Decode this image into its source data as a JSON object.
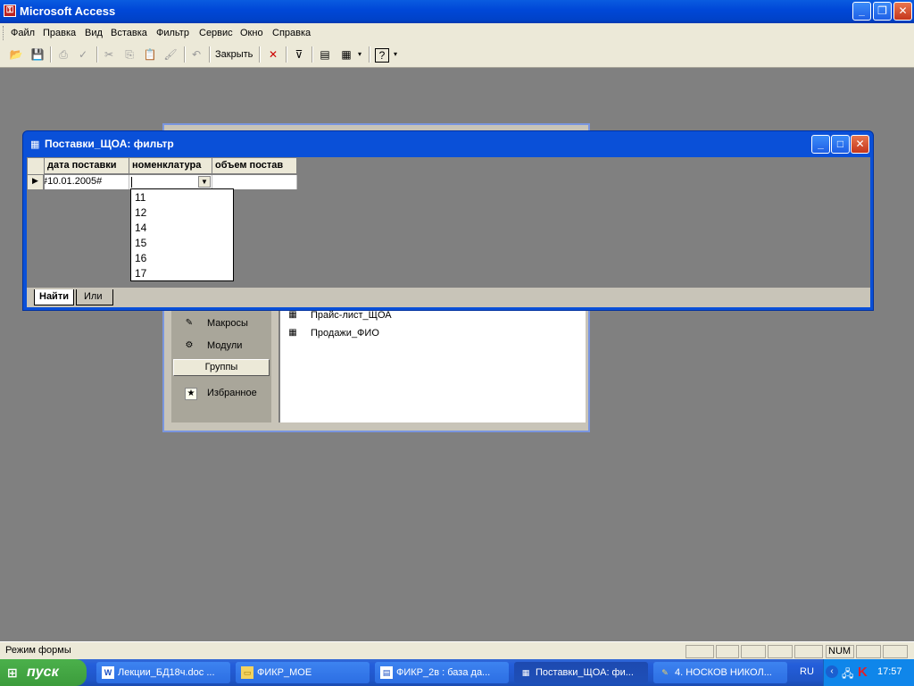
{
  "app": {
    "title": "Microsoft Access"
  },
  "menu": [
    "Файл",
    "Правка",
    "Вид",
    "Вставка",
    "Фильтр",
    "Сервис",
    "Окно",
    "Справка"
  ],
  "toolbar": {
    "close_label": "Закрыть"
  },
  "db_window": {
    "left_items": [
      "Макросы",
      "Модули"
    ],
    "groups_label": "Группы",
    "favorites_label": "Избранное",
    "objects": [
      "Прайс-лист_ЩОА",
      "Продажи_ФИО"
    ]
  },
  "filter_window": {
    "title": "Поставки_ЩОА: фильтр",
    "columns": [
      "дата поставки",
      "номенклатура",
      "объем постав"
    ],
    "row": {
      "date_value": "#10.01.2005#",
      "nomenclature_value": "",
      "volume_value": ""
    },
    "dropdown_options": [
      "11",
      "12",
      "14",
      "15",
      "16",
      "17"
    ],
    "tabs": [
      "Найти",
      "Или"
    ]
  },
  "status": {
    "mode": "Режим формы",
    "num": "NUM"
  },
  "taskbar": {
    "start_label": "пуск",
    "items": [
      "Лекции_БД18ч.doc ...",
      "ФИКР_МОЕ",
      "ФИКР_2в : база да...",
      "Поставки_ЩОА: фи...",
      "4. НОСКОВ НИКОЛ..."
    ],
    "lang": "RU",
    "clock": "17:57"
  }
}
